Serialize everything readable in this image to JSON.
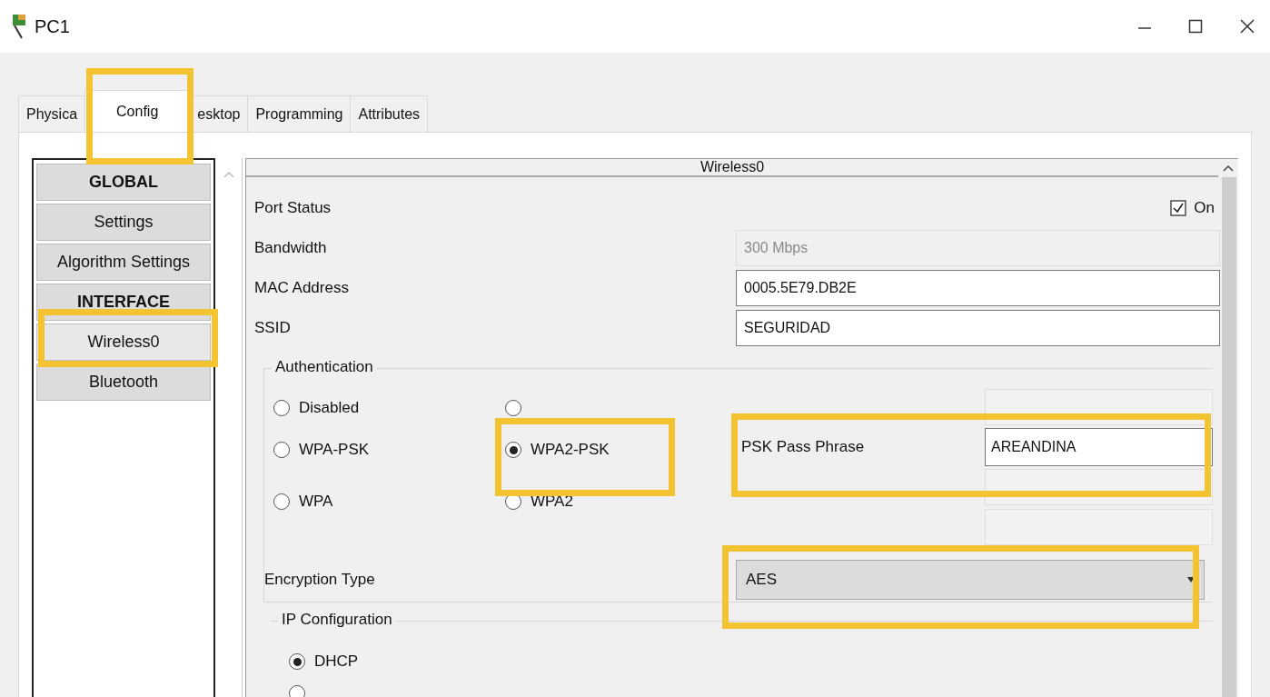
{
  "window": {
    "title": "PC1"
  },
  "tabs": [
    {
      "label": "Physica",
      "selected": false
    },
    {
      "label": "Config",
      "selected": true
    },
    {
      "label": "esktop",
      "selected": false
    },
    {
      "label": "Programming",
      "selected": false
    },
    {
      "label": "Attributes",
      "selected": false
    }
  ],
  "sidebar": {
    "items": [
      {
        "label": "GLOBAL",
        "kind": "header",
        "selected": false
      },
      {
        "label": "Settings",
        "kind": "item",
        "selected": false
      },
      {
        "label": "Algorithm Settings",
        "kind": "item",
        "selected": false
      },
      {
        "label": "INTERFACE",
        "kind": "header",
        "selected": false
      },
      {
        "label": "Wireless0",
        "kind": "item",
        "selected": true
      },
      {
        "label": "Bluetooth",
        "kind": "item",
        "selected": false
      }
    ]
  },
  "panel": {
    "title": "Wireless0",
    "port_status": {
      "label": "Port Status",
      "checked": true,
      "checkbox_label": "On"
    },
    "fields": [
      {
        "label": "Bandwidth",
        "value": "300 Mbps",
        "disabled": true
      },
      {
        "label": "MAC Address",
        "value": "0005.5E79.DB2E",
        "disabled": false
      },
      {
        "label": "SSID",
        "value": "SEGURIDAD",
        "disabled": false
      }
    ],
    "authentication": {
      "title": "Authentication",
      "options": [
        {
          "label": "Disabled",
          "selected": false
        },
        {
          "selected": false
        },
        {
          "label": "WPA-PSK",
          "selected": false
        },
        {
          "label": "WPA2-PSK",
          "selected": true
        },
        {
          "label": "WPA",
          "selected": false
        },
        {
          "label": "WPA2",
          "selected": false
        }
      ],
      "psk_pass_phrase": {
        "label": "PSK Pass Phrase",
        "value": "AREANDINA"
      }
    },
    "encryption_type": {
      "label": "Encryption Type",
      "value": "AES"
    },
    "ip_configuration": {
      "title": "IP Configuration",
      "options": [
        {
          "label": "DHCP",
          "selected": true
        },
        {
          "selected": false
        }
      ]
    }
  }
}
